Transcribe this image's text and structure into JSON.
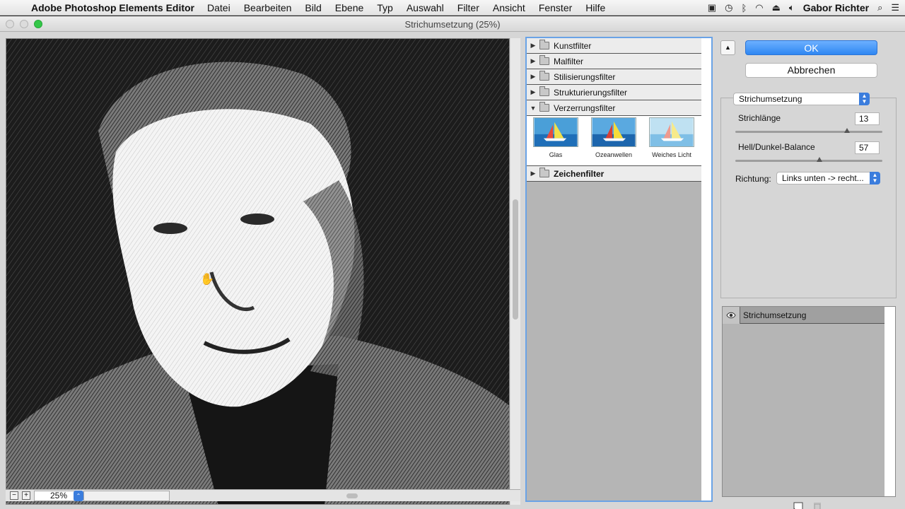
{
  "menubar": {
    "app_name": "Adobe Photoshop Elements Editor",
    "menus": [
      "Datei",
      "Bearbeiten",
      "Bild",
      "Ebene",
      "Typ",
      "Auswahl",
      "Filter",
      "Ansicht",
      "Fenster",
      "Hilfe"
    ],
    "user": "Gabor Richter"
  },
  "window": {
    "title": "Strichumsetzung (25%)"
  },
  "preview": {
    "zoom": "25%"
  },
  "gallery": {
    "categories": [
      {
        "label": "Kunstfilter",
        "expanded": false
      },
      {
        "label": "Malfilter",
        "expanded": false
      },
      {
        "label": "Stilisierungsfilter",
        "expanded": false
      },
      {
        "label": "Strukturierungsfilter",
        "expanded": false
      },
      {
        "label": "Verzerrungsfilter",
        "expanded": true
      },
      {
        "label": "Zeichenfilter",
        "expanded": false
      }
    ],
    "thumbnails": [
      {
        "label": "Glas"
      },
      {
        "label": "Ozeanwellen"
      },
      {
        "label": "Weiches Licht"
      }
    ]
  },
  "dialog": {
    "ok_label": "OK",
    "cancel_label": "Abbrechen",
    "filter_selected": "Strichumsetzung",
    "params": {
      "stroke_length": {
        "label": "Strichlänge",
        "value": "13",
        "fraction": 0.76
      },
      "balance": {
        "label": "Hell/Dunkel-Balance",
        "value": "57",
        "fraction": 0.57
      },
      "direction": {
        "label": "Richtung:",
        "value": "Links unten -> recht..."
      }
    },
    "layer_name": "Strichumsetzung"
  },
  "colors": {
    "accent": "#3b7ddd",
    "ok_button": "#3f93f7",
    "gallery_border": "#6aa3e6"
  }
}
